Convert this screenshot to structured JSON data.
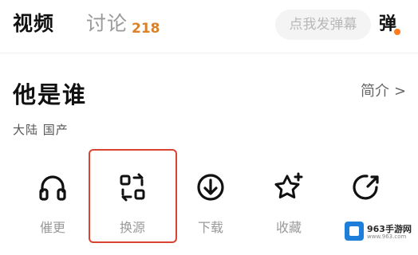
{
  "tabs": [
    {
      "label": "视频",
      "active": true
    },
    {
      "label": "讨论",
      "count": "218",
      "active": false
    }
  ],
  "danmaku": {
    "placeholder": "点我发弹幕",
    "toggle_label": "弹"
  },
  "video": {
    "title": "他是谁",
    "intro_label": "简介",
    "intro_chevron": ">",
    "meta": "大陆  国产"
  },
  "actions": [
    {
      "label": "催更",
      "icon": "headphones-icon"
    },
    {
      "label": "换源",
      "icon": "switch-source-icon",
      "highlighted": true
    },
    {
      "label": "下载",
      "icon": "download-icon"
    },
    {
      "label": "收藏",
      "icon": "star-add-icon"
    },
    {
      "label": "",
      "icon": "share-icon"
    }
  ],
  "watermark": {
    "name": "963手游网",
    "url": "www.963.com"
  },
  "colors": {
    "accent": "#d9822b",
    "highlight_border": "#d94432",
    "dot": "#ff7a1a",
    "watermark_blue": "#1d7fd9"
  }
}
